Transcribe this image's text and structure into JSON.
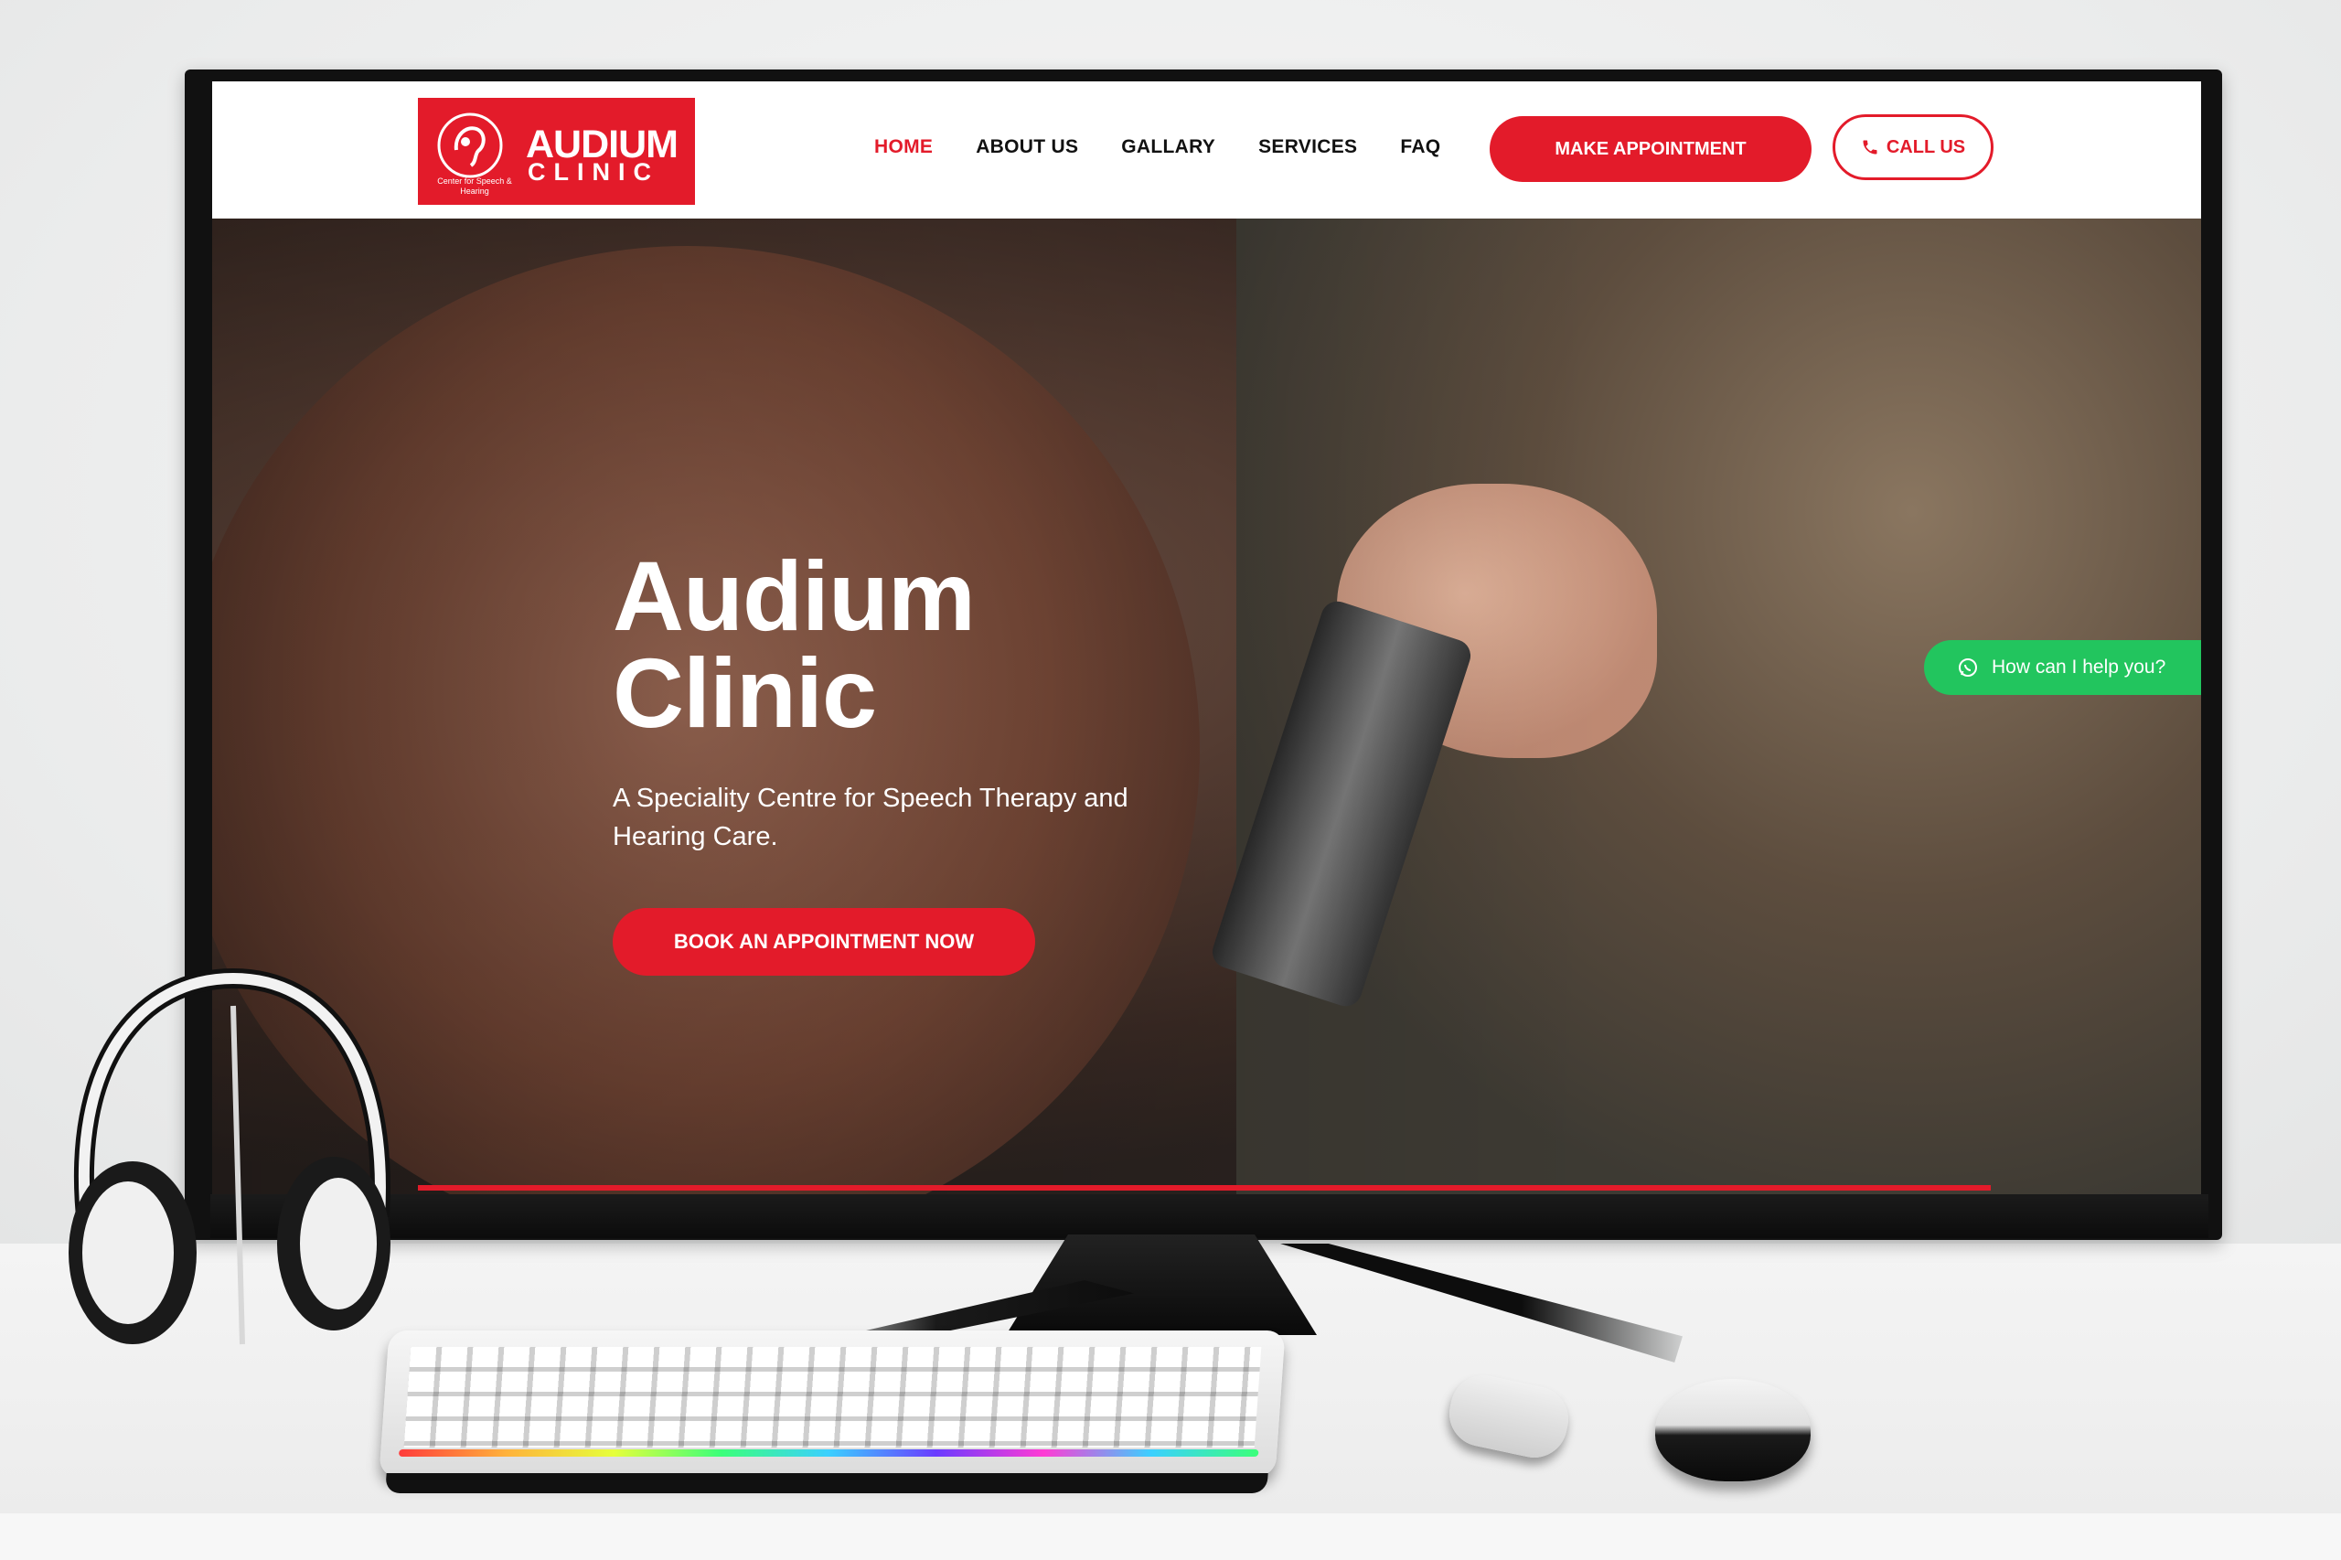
{
  "header": {
    "logo": {
      "word1": "AUDIUM",
      "word2": "CLINIC",
      "tagline": "Center for Speech & Hearing"
    },
    "nav": [
      {
        "label": "HOME",
        "active": true
      },
      {
        "label": "ABOUT US",
        "active": false
      },
      {
        "label": "GALLARY",
        "active": false
      },
      {
        "label": "SERVICES",
        "active": false
      },
      {
        "label": "FAQ",
        "active": false
      }
    ],
    "make_appointment_label": "MAKE APPOINTMENT",
    "call_us_label": "CALL US"
  },
  "hero": {
    "title_line1": "Audium",
    "title_line2": "Clinic",
    "subtitle": "A Speciality Centre for Speech Therapy and Hearing Care.",
    "cta_label": "BOOK AN APPOINTMENT NOW"
  },
  "chat_widget": {
    "label": "How can I help you?",
    "icon": "whatsapp-icon"
  },
  "colors": {
    "brand_red": "#e31b2a",
    "chat_green": "#22c55e"
  }
}
